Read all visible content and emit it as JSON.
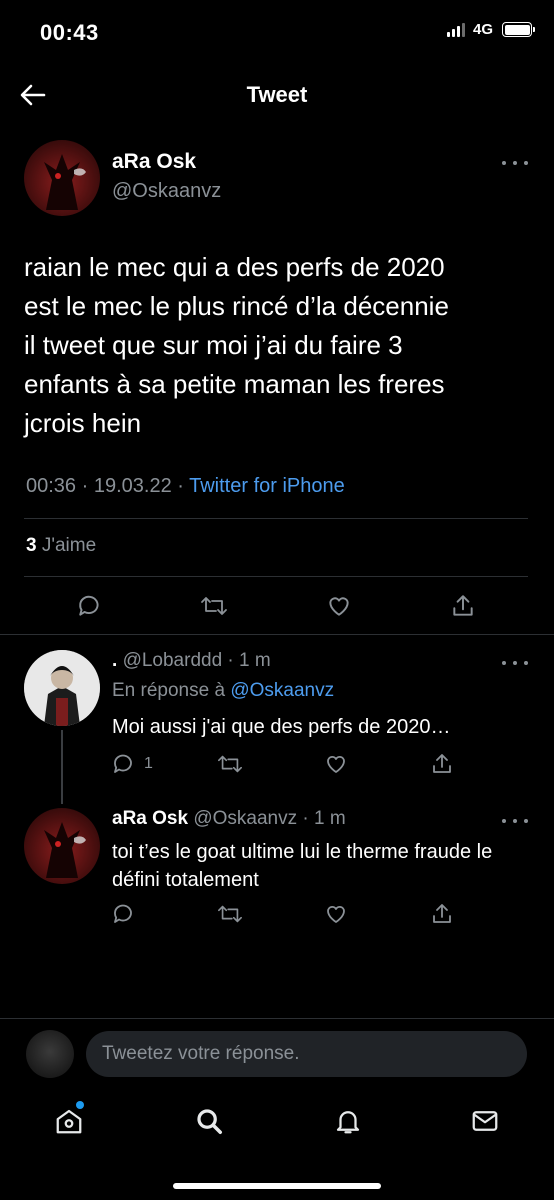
{
  "status_bar": {
    "time": "00:43",
    "network": "4G"
  },
  "header": {
    "title": "Tweet"
  },
  "main_tweet": {
    "author_name": "aRa Osk",
    "handle": "@Oskaanvz",
    "lines": [
      "raian le mec qui a des perfs de 2020",
      "est le mec le plus rincé d’la décennie",
      "il tweet que sur moi j’ai du faire 3",
      "enfants à sa petite maman les freres",
      "jcrois hein"
    ],
    "time": "00:36",
    "date": "19.03.22",
    "source": "Twitter for iPhone",
    "likes_count": "3",
    "likes_label": "J'aime"
  },
  "replies": [
    {
      "author_name": ".",
      "handle": "@Lobarddd",
      "age": "1 m",
      "reply_prefix": "En réponse à",
      "reply_to": "@Oskaanvz",
      "text": "Moi aussi j'ai que des perfs de 2020…",
      "reply_count": "1"
    },
    {
      "author_name": "aRa Osk",
      "handle": "@Oskaanvz",
      "age": "1 m",
      "lines": [
        "toi t’es le goat ultime lui le therme fraude le",
        "défini totalement"
      ]
    }
  ],
  "composer": {
    "placeholder": "Tweetez votre réponse."
  },
  "icons": {
    "back": "arrow-left-icon",
    "more": "more-horizontal-icon",
    "reply": "comment-icon",
    "retweet": "retweet-icon",
    "like": "heart-icon",
    "share": "share-icon",
    "nav": [
      "home-icon",
      "search-icon",
      "bell-icon",
      "mail-icon"
    ]
  },
  "colors": {
    "accent": "#1d9bf0",
    "link": "#4d9cee",
    "background": "#000000",
    "muted": "#8b9197"
  }
}
